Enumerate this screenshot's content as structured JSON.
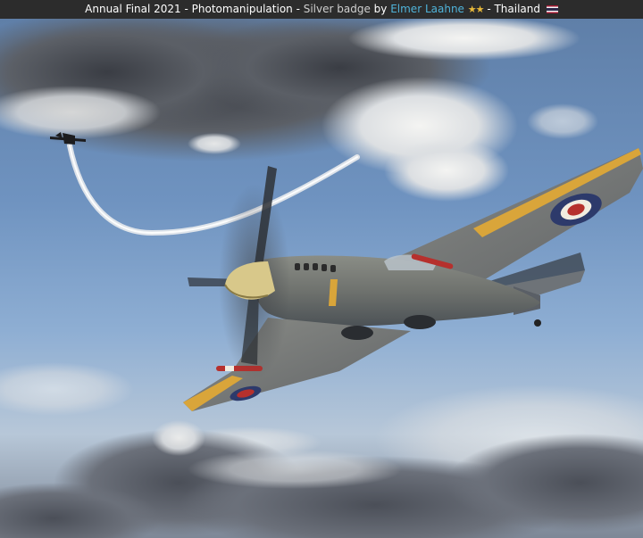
{
  "caption": {
    "category": "Annual Final 2021 - Photomanipulation - ",
    "award": "Silver badge",
    "by": " by ",
    "author": "Elmer Laahne",
    "stars": "★★",
    "country_sep": " - ",
    "country": "Thailand",
    "flag_icon": "thailand-flag-icon"
  },
  "colors": {
    "bar_bg": "#2c2c2c",
    "author_link": "#4fb3d9",
    "star": "#e8b93a"
  }
}
